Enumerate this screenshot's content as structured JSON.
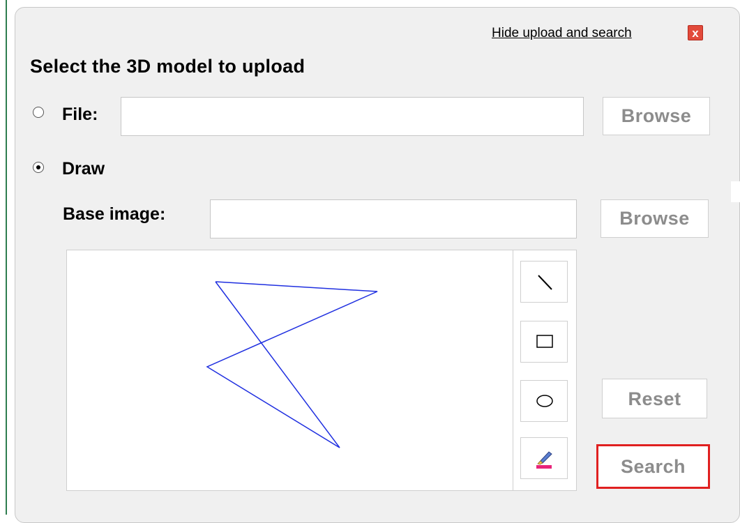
{
  "header": {
    "hide_link": "Hide upload and search",
    "close_symbol": "x"
  },
  "heading": "Select the 3D model to upload",
  "file_option": {
    "label": "File:",
    "selected": false,
    "value": "",
    "browse_label": "Browse"
  },
  "draw_option": {
    "label": "Draw",
    "selected": true,
    "base_image_label": "Base image:",
    "base_image_value": "",
    "browse_label": "Browse"
  },
  "tools": [
    {
      "name": "line-tool",
      "icon": "line-icon"
    },
    {
      "name": "rectangle-tool",
      "icon": "rectangle-icon"
    },
    {
      "name": "ellipse-tool",
      "icon": "ellipse-icon"
    },
    {
      "name": "eraser-tool",
      "icon": "eraser-icon"
    }
  ],
  "actions": {
    "reset_label": "Reset",
    "search_label": "Search"
  },
  "colors": {
    "stroke": "#1f2fe0",
    "highlight": "#e02020",
    "panel": "#f0f0f0",
    "close": "#e24a3b"
  }
}
